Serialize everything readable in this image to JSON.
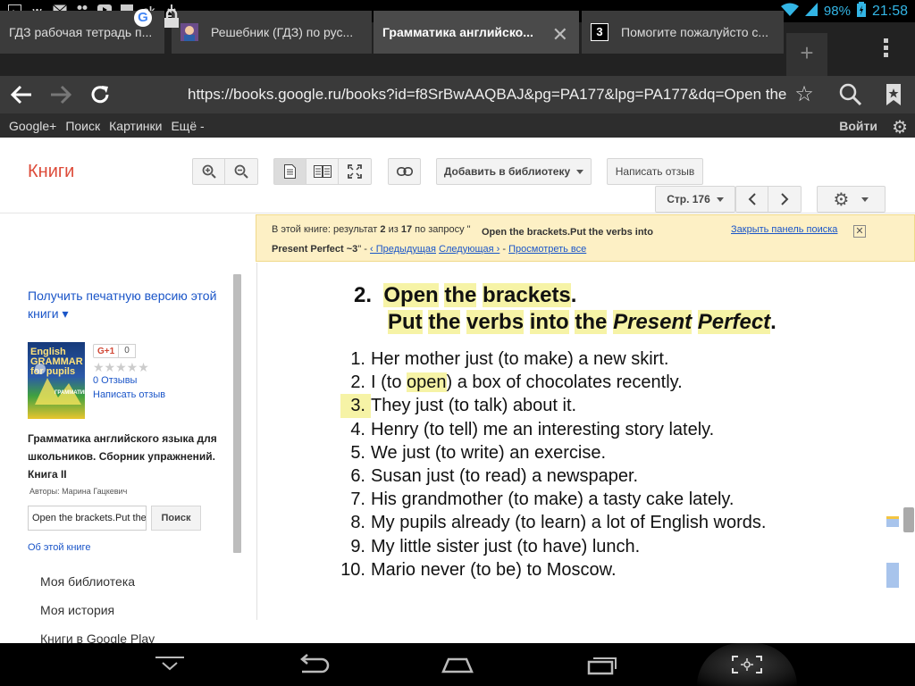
{
  "status_bar": {
    "battery": "98%",
    "time": "21:58",
    "icons": [
      "image-icon",
      "vk-icon",
      "mail-icon",
      "group-icon",
      "youtube-icon",
      "chat-icon",
      "odnoklassniki-icon",
      "download-icon",
      "wifi-icon",
      "signal-icon",
      "battery-icon"
    ]
  },
  "tabs": [
    {
      "title": "ГДЗ рабочая тетрадь п...",
      "active": false
    },
    {
      "title": "Решебник (ГДЗ) по рус...",
      "active": false
    },
    {
      "title": "Грамматика английско...",
      "active": true
    },
    {
      "title": "Помогите пожалуйсто с...",
      "active": false
    }
  ],
  "tab_badge": "3",
  "url": "https://books.google.ru/books?id=f8SrBwAAQBAJ&pg=PA177&lpg=PA177&dq=Open the brackets",
  "google_bar": {
    "items": [
      "Google+",
      "Поиск",
      "Картинки",
      "Ещё -"
    ],
    "signin": "Войти"
  },
  "books": {
    "title": "Книги",
    "add_library": "Добавить в библиотеку",
    "write_review": "Написать отзыв",
    "page_select": "Стр. 176"
  },
  "search_panel": {
    "line1_pre": "В этой книге: результат ",
    "result_index": "2",
    "line1_mid": " из ",
    "result_total": "17",
    "line1_query_pre": " по запросу \"",
    "query": "Open the brackets.Put the verbs into Present Perfect ~3",
    "line1_query_post": "\"",
    "sep1": " - ",
    "prev": "‹ Предыдущая",
    "next": "Следующая ›",
    "sep2": " - ",
    "view_all": "Просмотреть все",
    "close": "Закрыть панель поиска"
  },
  "sidebar": {
    "print_link": "Получить печатную версию этой книги ▾",
    "gplus": "G+1",
    "gplus_count": "0",
    "review_count": "0 Отзывы",
    "write_review": "Написать отзыв",
    "book_title": "Грамматика английского языка для школьников. Сборник упражнений. Книга II",
    "authors": "Авторы: Марина Гацкевич",
    "search_value": "Open the brackets.Put the",
    "search_button": "Поиск",
    "about": "Об этой книге",
    "menu": [
      "Моя библиотека",
      "Моя история",
      "Книги в Google Play"
    ],
    "cover_title": "English GRAMMAR for pupils",
    "cover_subtitle": "ГРАММАТИКА АНГЛИЙСКОГО ЯЗЫКА"
  },
  "page": {
    "exercise_number": "2.",
    "title_words": [
      "Open",
      "the",
      "brackets"
    ],
    "title_end": ".",
    "sub_words": [
      "Put",
      "the",
      "verbs",
      "into",
      "the"
    ],
    "sub_italic": [
      "Present",
      "Perfect"
    ],
    "sub_end": ".",
    "items": [
      {
        "num": "1.",
        "text": "Her mother just (to make) a new skirt."
      },
      {
        "num": "2.",
        "pre": "I (to ",
        "hl": "open",
        "post": ") a box of chocolates recently."
      },
      {
        "num": "3.",
        "text": "They just (to talk) about it."
      },
      {
        "num": "4.",
        "text": "Henry (to tell) me an interesting story lately."
      },
      {
        "num": "5.",
        "text": "We just (to write) an exercise."
      },
      {
        "num": "6.",
        "text": "Susan just (to read) a newspaper."
      },
      {
        "num": "7.",
        "text": "His grandmother (to make) a tasty cake lately."
      },
      {
        "num": "8.",
        "text": "My pupils already (to learn) a lot of English words."
      },
      {
        "num": "9.",
        "text": "My little sister just (to have) lunch."
      },
      {
        "num": "10.",
        "text": "Mario never (to be) to Moscow."
      }
    ]
  },
  "colors": {
    "highlight": "#f6f3a6",
    "link": "#1a55c8",
    "books_red": "#dd4b39",
    "status_blue": "#33b5e5",
    "search_panel_bg": "#fdf0c5"
  }
}
